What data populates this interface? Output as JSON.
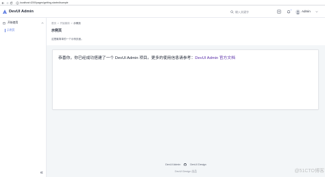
{
  "browser": {
    "url": "localhost:4200/pages/getting-started/sample",
    "icons": [
      "back-arrow-icon",
      "forward-arrow-icon",
      "reload-icon",
      "site-info-icon"
    ]
  },
  "header": {
    "logo_icon": "devui-logo-icon",
    "app_title": "DevUI Admin",
    "search": {
      "icon": "search-icon",
      "placeholder": "输入关键字",
      "value": ""
    },
    "actions": [
      {
        "icon": "language-icon"
      },
      {
        "icon": "bell-icon",
        "badge": true
      }
    ],
    "user": {
      "avatar_icon": "user-avatar-icon",
      "name": "Admin",
      "menu_icon": "chevron-down-icon"
    }
  },
  "sidebar": {
    "menu": [
      {
        "icon": "window-icon",
        "label": "开始使用",
        "expanded": true,
        "toggle_icon": "chevron-up-icon",
        "children": [
          {
            "label": "示例页",
            "selected": true
          }
        ]
      }
    ],
    "collapse_icon": "double-chevron-left-icon"
  },
  "main": {
    "breadcrumb": {
      "items": [
        "首页",
        "开始使用",
        "示例页"
      ],
      "separator": ">"
    },
    "page_title": "示例页",
    "page_description": "这是最简单的一个示例页面。",
    "card": {
      "text": "恭喜你，你已经成功搭建了一个 DevUI Admin 项目。更多的使用信息请参考：",
      "link_label": "DevUI Admin 官方文档"
    }
  },
  "footer": {
    "links": [
      {
        "label": "DevUI Admin"
      },
      {
        "icon": "github-icon"
      },
      {
        "label": "DevUI Design"
      }
    ],
    "credit": "DevUI Design 出品"
  },
  "watermark": "@51CTO博客",
  "colors": {
    "brand": "#5e7ce0",
    "link": "#5b2fa8",
    "text": "#252b3a",
    "muted": "#8a8e99",
    "page_bg": "#f3f6f8",
    "badge": "#5e7ce0"
  }
}
